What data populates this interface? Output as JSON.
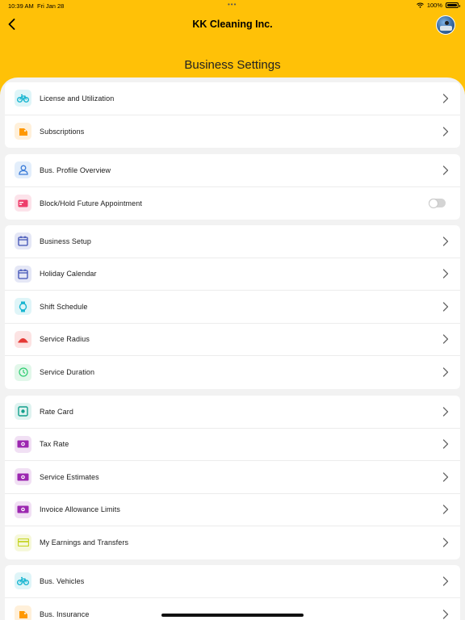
{
  "status": {
    "time": "10:39 AM",
    "date": "Fri Jan 28",
    "battery": "100%"
  },
  "nav": {
    "title": "KK Cleaning Inc."
  },
  "page": {
    "title": "Business Settings"
  },
  "groups": [
    {
      "items": [
        {
          "label": "License and Utilization",
          "icon": "bicycle-icon",
          "color": "#19B6D1",
          "bg": "#DFF5F8"
        },
        {
          "label": "Subscriptions",
          "icon": "tag-icon",
          "color": "#FF9800",
          "bg": "#FFF0DA"
        }
      ]
    },
    {
      "items": [
        {
          "label": "Bus. Profile Overview",
          "icon": "person-icon",
          "color": "#3B7CD8",
          "bg": "#E3EEFB"
        },
        {
          "label": "Block/Hold Future Appointment",
          "icon": "card-icon",
          "color": "#EE3F6C",
          "bg": "#FCE3EA",
          "toggle": false
        }
      ]
    },
    {
      "items": [
        {
          "label": "Business Setup",
          "icon": "calendar-icon",
          "color": "#3F51B5",
          "bg": "#E5E7F6"
        },
        {
          "label": "Holiday Calendar",
          "icon": "calendar-icon",
          "color": "#3F51B5",
          "bg": "#E5E7F6"
        },
        {
          "label": "Shift Schedule",
          "icon": "watch-icon",
          "color": "#19B6D1",
          "bg": "#DFF5F8"
        },
        {
          "label": "Service Radius",
          "icon": "radius-icon",
          "color": "#E53935",
          "bg": "#FCE3E3"
        },
        {
          "label": "Service Duration",
          "icon": "clock-icon",
          "color": "#2ECC71",
          "bg": "#E2F7EA"
        }
      ]
    },
    {
      "items": [
        {
          "label": "Rate Card",
          "icon": "rate-card-icon",
          "color": "#12A08C",
          "bg": "#DFF3F0"
        },
        {
          "label": "Tax Rate",
          "icon": "money-icon",
          "color": "#9C27B0",
          "bg": "#F1E0F4"
        },
        {
          "label": "Service Estimates",
          "icon": "money-icon",
          "color": "#9C27B0",
          "bg": "#F1E0F4"
        },
        {
          "label": "Invoice Allowance Limits",
          "icon": "money-icon",
          "color": "#9C27B0",
          "bg": "#F1E0F4"
        },
        {
          "label": "My Earnings and Transfers",
          "icon": "credit-card-icon",
          "color": "#C6D52A",
          "bg": "#F6F8DA"
        }
      ]
    },
    {
      "items": [
        {
          "label": "Bus. Vehicles",
          "icon": "bicycle-icon",
          "color": "#19B6D1",
          "bg": "#DFF5F8"
        },
        {
          "label": "Bus. Insurance",
          "icon": "tag-icon",
          "color": "#FF9800",
          "bg": "#FFF0DA"
        }
      ]
    }
  ]
}
